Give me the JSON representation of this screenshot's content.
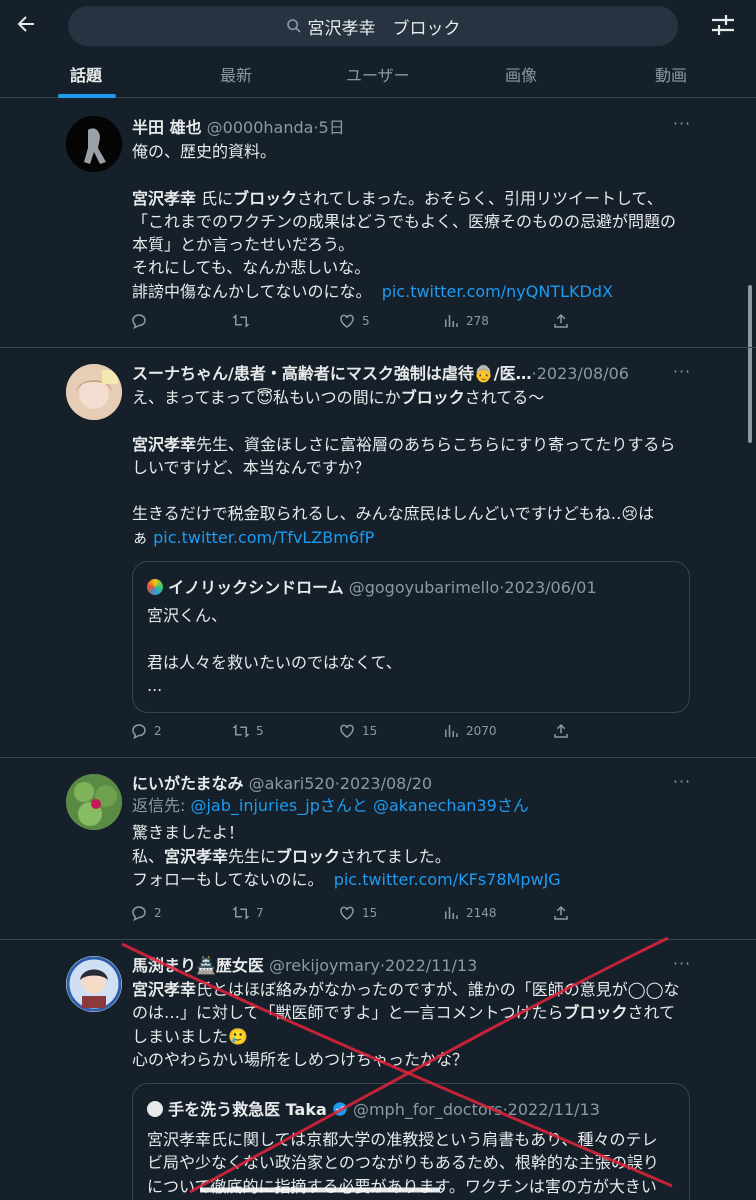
{
  "search": {
    "query": "宮沢孝幸　ブロック"
  },
  "tabs": [
    "話題",
    "最新",
    "ユーザー",
    "画像",
    "動画"
  ],
  "tweets": [
    {
      "name": "半田 雄也",
      "handle": "@0000handa",
      "date": "5日",
      "lines": [
        "俺の、歴史的資料。"
      ],
      "p2_bold": "宮沢孝幸",
      "p2_a": " 氏に",
      "p2_bold2": "ブロック",
      "p2_b": "されてしまった。おそらく、引用リツイートして、",
      "p3": "「これまでのワクチンの成果はどうでもよく、医療そのものの忌避が問題の",
      "p4": "本質」とか言ったせいだろう。",
      "p5": "それにしても、なんか悲しいな。",
      "p6": "誹謗中傷なんかしてないのにな。",
      "link": "pic.twitter.com/nyQNTLKDdX",
      "replies": "",
      "retweets": "",
      "likes": "5",
      "views": "278"
    },
    {
      "name": "スーナちゃん/患者・高齢者にマスク強制は虐待👵/医…",
      "date": "2023/08/06",
      "l1a": "え、まってまって😇私もいつの間にか",
      "l1b": "ブロック",
      "l1c": "されてる〜",
      "l2a": "宮沢孝幸",
      "l2b": "先生、資金ほしさに富裕層のあちらこちらにすり寄ってたりするら",
      "l3": "しいですけど、本当なんですか？",
      "l4": "生きるだけで税金取られるし、みんな庶民はしんどいですけどもね‥😢は",
      "l5a": "ぁ ",
      "link": "pic.twitter.com/TfvLZBm6fP",
      "quote": {
        "name": "イノリックシンドローム",
        "handle": "@gogoyubarimello",
        "date": "2023/06/01",
        "l1": "宮沢くん、",
        "l2": "君は人々を救いたいのではなくて、",
        "l3": "..."
      },
      "replies": "2",
      "retweets": "5",
      "likes": "15",
      "views": "2070"
    },
    {
      "name": "にいがたまなみ",
      "handle": "@akari520",
      "date": "2023/08/20",
      "reply_prefix": "返信先: ",
      "reply_to1": "@jab_injuries_jp",
      "reply_mid": "さんと",
      "reply_to2": "@akanechan39",
      "reply_suffix": "さん",
      "l1": "驚きましたよ！",
      "l2a": "私、",
      "l2b": "宮沢孝幸",
      "l2c": "先生に",
      "l2d": "ブロック",
      "l2e": "されてました。",
      "l3": "フォローもしてないのに。",
      "link": "pic.twitter.com/KFs78MpwJG",
      "replies": "2",
      "retweets": "7",
      "likes": "15",
      "views": "2148"
    },
    {
      "name": "馬渕まり🏯歴女医",
      "handle": "@rekijoymary",
      "date": "2022/11/13",
      "l1a": "宮沢孝幸",
      "l1b": "氏とはほぼ絡みがなかったのですが、誰かの「医師の意見が◯◯な",
      "l2a": "のは…」に対して「獣医師ですよ」と一言コメントつけたら",
      "l2b": "ブロック",
      "l2c": "されて",
      "l3": "しまいました🥲",
      "l4": "心のやわらかい場所をしめつけちゃったかな？",
      "quote": {
        "name": "手を洗う救急医 Taka",
        "handle": "@mph_for_doctors",
        "date": "2022/11/13",
        "l1": "宮沢孝幸氏に関しては京都大学の准教授という肩書もあり、種々のテレ",
        "l2": "ビ局や少なくない政治家とのつながりもあるため、根幹的な主張の誤り",
        "l3": "について徹底的に指摘する必要があります。ワクチンは害の方が大きい"
      }
    }
  ],
  "colors": {
    "background": "#15202b",
    "accent": "#1d9bf0",
    "muted": "#8b98a5",
    "cross": "#e0243a"
  }
}
